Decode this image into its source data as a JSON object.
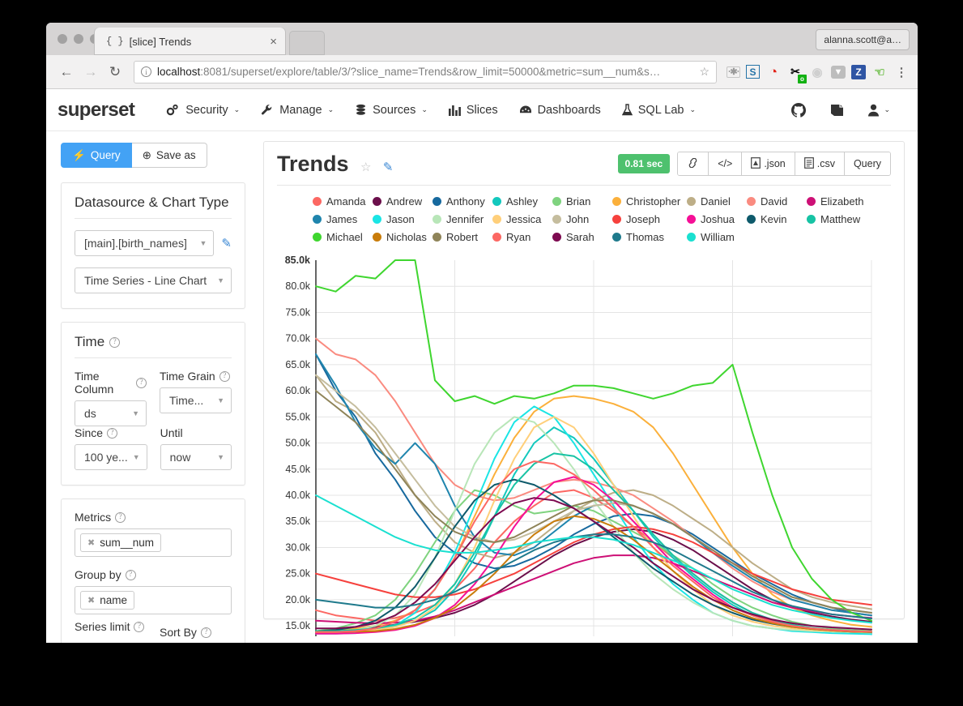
{
  "browser": {
    "tab": {
      "favicon": "{ }",
      "title": "[slice] Trends",
      "close": "×"
    },
    "nav": {
      "back": "←",
      "forward": "→",
      "reload": "↻"
    },
    "url": {
      "host": "localhost",
      "rest": ":8081/superset/explore/table/3/?slice_name=Trends&row_limit=50000&metric=sum__num&s…",
      "info_icon": "info-icon",
      "star_icon": "bookmark-star-icon"
    },
    "profile": "alanna.scott@a…",
    "extensions": [
      "puzzle-icon",
      "s-icon",
      "opera-icon",
      "screenshot-icon",
      "target-icon",
      "pocket-icon",
      "zotero-icon",
      "hangouts-icon",
      "chrome-menu-icon"
    ]
  },
  "navbar": {
    "brand": "superset",
    "items": [
      {
        "label": "Security",
        "icon": "gears-icon",
        "caret": "⌄"
      },
      {
        "label": "Manage",
        "icon": "wrench-icon",
        "caret": "⌄"
      },
      {
        "label": "Sources",
        "icon": "database-icon",
        "caret": "⌄"
      },
      {
        "label": "Slices",
        "icon": "bar-chart-icon",
        "caret": ""
      },
      {
        "label": "Dashboards",
        "icon": "dashboard-icon",
        "caret": ""
      },
      {
        "label": "SQL Lab",
        "icon": "flask-icon",
        "caret": "⌄"
      }
    ],
    "right_icons": [
      "github-icon",
      "book-icon",
      "user-icon"
    ],
    "user_caret": "⌄"
  },
  "sidebar": {
    "query_button": "Query",
    "query_icon": "⚡",
    "save_button": "Save as",
    "save_icon": "⊕",
    "datasource_panel": {
      "title": "Datasource & Chart Type",
      "datasource": "[main].[birth_names]",
      "edit_icon": "edit-datasource-icon",
      "viz_type": "Time Series - Line Chart"
    },
    "time_panel": {
      "title": "Time",
      "time_column_label": "Time Column",
      "time_column_value": "ds",
      "time_grain_label": "Time Grain",
      "time_grain_value": "Time...",
      "since_label": "Since",
      "since_value": "100 ye...",
      "until_label": "Until",
      "until_value": "now"
    },
    "query_panel": {
      "metrics_label": "Metrics",
      "metrics_token": "sum__num",
      "groupby_label": "Group by",
      "groupby_token": "name",
      "series_limit_label": "Series limit",
      "sort_by_label": "Sort By",
      "token_x": "✖"
    },
    "help_icon": "?"
  },
  "chart_panel": {
    "title": "Trends",
    "star_icon": "☆",
    "edit_icon": "✎",
    "duration_badge": "0.81 sec",
    "buttons": [
      {
        "label": "",
        "icon": "link-icon"
      },
      {
        "label": "",
        "icon": "code-icon"
      },
      {
        "label": ".json",
        "icon": "file-json-icon"
      },
      {
        "label": ".csv",
        "icon": "file-csv-icon"
      },
      {
        "label": "Query",
        "icon": ""
      }
    ]
  },
  "chart_data": {
    "type": "line",
    "title": "Trends",
    "xlabel": "",
    "ylabel": "",
    "ylim": [
      13000,
      85000
    ],
    "yticks": [
      "85.0k",
      "80.0k",
      "75.0k",
      "70.0k",
      "65.0k",
      "60.0k",
      "55.0k",
      "50.0k",
      "45.0k",
      "40.0k",
      "35.0k",
      "30.0k",
      "25.0k",
      "20.0k",
      "15.0k"
    ],
    "grid": true,
    "legend_position": "top",
    "legend_columns": 5,
    "x": [
      0,
      1,
      2,
      3,
      4,
      5,
      6,
      7,
      8,
      9,
      10,
      11,
      12,
      13,
      14,
      15,
      16,
      17,
      18,
      19,
      20,
      21,
      22,
      23,
      24,
      25,
      26,
      27,
      28
    ],
    "series": [
      {
        "name": "Amanda",
        "color": "#fc6863",
        "values": [
          18000,
          17000,
          16500,
          16000,
          16500,
          17500,
          19000,
          22000,
          26000,
          31000,
          35000,
          38000,
          40500,
          41000,
          39500,
          37000,
          34000,
          31000,
          28000,
          25000,
          22000,
          19500,
          17500,
          16000,
          15000,
          14500,
          14000,
          13800,
          13500
        ]
      },
      {
        "name": "Andrew",
        "color": "#6b0f4b",
        "values": [
          14000,
          14200,
          14500,
          14800,
          15200,
          15800,
          16500,
          17500,
          19000,
          21000,
          23500,
          26000,
          28500,
          30500,
          32000,
          33000,
          33500,
          33000,
          31500,
          29500,
          27000,
          24500,
          22000,
          20000,
          18500,
          17500,
          16800,
          16200,
          15800
        ]
      },
      {
        "name": "Anthony",
        "color": "#17699e",
        "values": [
          67000,
          60000,
          55000,
          48000,
          43000,
          37000,
          32000,
          29000,
          27000,
          26000,
          26500,
          28000,
          30000,
          32500,
          34500,
          36000,
          36500,
          36000,
          34500,
          32500,
          30000,
          27500,
          25000,
          23000,
          21000,
          19500,
          18500,
          17500,
          17000
        ]
      },
      {
        "name": "Ashley",
        "color": "#13c8bd",
        "values": [
          14000,
          14000,
          14200,
          14500,
          15000,
          16000,
          18000,
          22000,
          28000,
          36000,
          44000,
          50000,
          53000,
          51000,
          47000,
          42000,
          37000,
          32000,
          28000,
          24500,
          21500,
          19000,
          17000,
          15800,
          15000,
          14500,
          14200,
          14000,
          13800
        ]
      },
      {
        "name": "Brian",
        "color": "#7fd37f",
        "values": [
          14000,
          14500,
          15500,
          17000,
          20000,
          25000,
          31000,
          37000,
          41000,
          40000,
          38000,
          36500,
          37000,
          38000,
          37000,
          35000,
          33000,
          31000,
          28500,
          26000,
          23000,
          20500,
          18500,
          17000,
          15800,
          15000,
          14500,
          14200,
          14000
        ]
      },
      {
        "name": "Christopher",
        "color": "#fbb03b",
        "values": [
          14000,
          14200,
          14500,
          15000,
          16000,
          18000,
          22000,
          28000,
          36000,
          44000,
          51000,
          56000,
          58500,
          59000,
          58500,
          57500,
          56000,
          53000,
          48000,
          42000,
          36000,
          30000,
          25000,
          21000,
          18500,
          17000,
          16000,
          15200,
          14800
        ]
      },
      {
        "name": "Daniel",
        "color": "#bdae87",
        "values": [
          63000,
          58000,
          56000,
          52000,
          46000,
          40000,
          35000,
          31000,
          29000,
          28000,
          29000,
          31000,
          34000,
          37000,
          39000,
          40500,
          41000,
          40000,
          38000,
          35500,
          33000,
          30000,
          27000,
          24500,
          22000,
          20500,
          19500,
          18800,
          18200
        ]
      },
      {
        "name": "David",
        "color": "#fa8b80",
        "values": [
          70000,
          67000,
          66000,
          63000,
          58000,
          52000,
          46000,
          42000,
          40000,
          39000,
          39500,
          41000,
          42500,
          43000,
          42500,
          41500,
          40000,
          37500,
          35000,
          32000,
          29000,
          26000,
          23500,
          21500,
          20000,
          19000,
          18000,
          17500,
          17000
        ]
      },
      {
        "name": "Elizabeth",
        "color": "#cd1076",
        "values": [
          16000,
          15800,
          15600,
          15500,
          15600,
          16000,
          16800,
          18000,
          19500,
          21000,
          22500,
          24000,
          25500,
          27000,
          28000,
          28500,
          28500,
          28000,
          27000,
          25500,
          24000,
          22500,
          21000,
          19500,
          18500,
          17800,
          17200,
          16800,
          16500
        ]
      },
      {
        "name": "James",
        "color": "#1f85ad",
        "values": [
          67000,
          61000,
          54000,
          49000,
          46000,
          50000,
          46000,
          38000,
          32000,
          29000,
          28500,
          30000,
          33000,
          36000,
          38000,
          38500,
          38000,
          36500,
          34500,
          32000,
          29000,
          26500,
          24000,
          22000,
          20000,
          19000,
          18000,
          17500,
          17000
        ]
      },
      {
        "name": "Jason",
        "color": "#1ae5e5",
        "values": [
          13500,
          13500,
          13600,
          14000,
          15000,
          17500,
          22000,
          29000,
          38000,
          47000,
          54000,
          57000,
          55000,
          50000,
          44000,
          38000,
          32000,
          27000,
          23000,
          20000,
          17500,
          16000,
          15000,
          14500,
          14000,
          13800,
          13600,
          13500,
          13400
        ]
      },
      {
        "name": "Jennifer",
        "color": "#b8e6b8",
        "values": [
          14000,
          14000,
          14200,
          15000,
          17000,
          21000,
          28000,
          37000,
          46000,
          52000,
          55000,
          54000,
          50000,
          45000,
          39000,
          34000,
          29000,
          25000,
          22000,
          19500,
          17500,
          16000,
          15000,
          14500,
          14200,
          14000,
          13900,
          13800,
          13700
        ]
      },
      {
        "name": "Jessica",
        "color": "#ffcf7a",
        "values": [
          13800,
          13800,
          14000,
          14200,
          14800,
          16000,
          18500,
          23000,
          30000,
          39000,
          47000,
          53000,
          55000,
          53000,
          48000,
          42000,
          36000,
          30000,
          25500,
          22000,
          19000,
          17000,
          15800,
          15000,
          14500,
          14200,
          14000,
          13900,
          13800
        ]
      },
      {
        "name": "John",
        "color": "#c5bd9e",
        "values": [
          63000,
          60000,
          57000,
          53000,
          48000,
          43000,
          38000,
          34000,
          32000,
          31000,
          31500,
          33000,
          35000,
          37000,
          38000,
          38500,
          38000,
          36500,
          34500,
          32000,
          29500,
          27000,
          24500,
          22500,
          20500,
          19500,
          18500,
          18000,
          17500
        ]
      },
      {
        "name": "Joseph",
        "color": "#f6413d",
        "values": [
          25000,
          24000,
          23000,
          22000,
          21000,
          20500,
          20500,
          21000,
          22000,
          23500,
          25000,
          27000,
          29000,
          31000,
          32500,
          33500,
          34000,
          33500,
          32500,
          31000,
          29000,
          27000,
          25000,
          23500,
          22000,
          21000,
          20000,
          19500,
          19000
        ]
      },
      {
        "name": "Joshua",
        "color": "#f50f96",
        "values": [
          13500,
          13500,
          13600,
          13800,
          14200,
          15000,
          16500,
          19000,
          23000,
          28000,
          34000,
          39000,
          42500,
          43500,
          42000,
          39000,
          35000,
          31000,
          27000,
          24000,
          21000,
          18500,
          17000,
          15800,
          15000,
          14500,
          14200,
          14000,
          13800
        ]
      },
      {
        "name": "Kevin",
        "color": "#0e5a6b",
        "values": [
          14000,
          14200,
          14800,
          16000,
          18500,
          22500,
          28000,
          34000,
          39000,
          42000,
          43000,
          42000,
          40000,
          37500,
          35000,
          32000,
          29000,
          26000,
          23500,
          21000,
          19000,
          17500,
          16200,
          15400,
          14800,
          14400,
          14100,
          13900,
          13800
        ]
      },
      {
        "name": "Matthew",
        "color": "#17c3a4",
        "values": [
          14000,
          14000,
          14200,
          14500,
          15200,
          16500,
          19000,
          23000,
          29000,
          36000,
          42000,
          46000,
          48000,
          47500,
          45000,
          41000,
          37000,
          32500,
          28500,
          25000,
          22000,
          19500,
          17500,
          16200,
          15200,
          14600,
          14200,
          14000,
          13800
        ]
      },
      {
        "name": "Michael",
        "color": "#3fd62f",
        "values": [
          80000,
          79000,
          82000,
          81500,
          85000,
          85000,
          62000,
          58000,
          59000,
          57500,
          59000,
          58500,
          59500,
          61000,
          61000,
          60500,
          59500,
          58500,
          59500,
          61000,
          61500,
          65000,
          52000,
          40000,
          30000,
          24000,
          20000,
          17500,
          16000
        ]
      },
      {
        "name": "Nicholas",
        "color": "#c97c0a",
        "values": [
          13800,
          13800,
          13900,
          14000,
          14400,
          15200,
          16500,
          18500,
          21500,
          25000,
          29000,
          32500,
          35000,
          36000,
          35500,
          34000,
          31500,
          28500,
          25500,
          22500,
          20000,
          18000,
          16500,
          15500,
          14800,
          14400,
          14100,
          13900,
          13800
        ]
      },
      {
        "name": "Robert",
        "color": "#8f8459",
        "values": [
          60000,
          57000,
          54000,
          50000,
          45000,
          40000,
          36000,
          33000,
          31500,
          31000,
          32000,
          34000,
          36000,
          38000,
          39000,
          39000,
          38000,
          36500,
          34500,
          32000,
          29500,
          27000,
          24500,
          22500,
          20500,
          19500,
          18500,
          18000,
          17500
        ]
      },
      {
        "name": "Ryan",
        "color": "#fc6863",
        "values": [
          13800,
          13800,
          14000,
          14500,
          15800,
          18000,
          22000,
          28000,
          35000,
          41000,
          45000,
          46500,
          46000,
          44000,
          41000,
          37500,
          34000,
          30000,
          26500,
          23500,
          20500,
          18500,
          17000,
          15800,
          15000,
          14500,
          14200,
          14000,
          13900
        ]
      },
      {
        "name": "Sarah",
        "color": "#7d0a50",
        "values": [
          14500,
          14500,
          14800,
          15500,
          17000,
          19500,
          23000,
          27500,
          32000,
          36000,
          38500,
          39500,
          39000,
          37500,
          35000,
          32500,
          30000,
          27000,
          24500,
          22000,
          20000,
          18500,
          17200,
          16200,
          15500,
          15000,
          14700,
          14500,
          14300
        ]
      },
      {
        "name": "Thomas",
        "color": "#1f7a8c",
        "values": [
          20000,
          19500,
          19000,
          18500,
          18500,
          19000,
          20000,
          21500,
          23500,
          25500,
          27500,
          29500,
          31000,
          32000,
          32500,
          32500,
          32000,
          31000,
          29500,
          27500,
          25500,
          23500,
          21500,
          20000,
          18800,
          18000,
          17200,
          16800,
          16400
        ]
      },
      {
        "name": "William",
        "color": "#1ae0d0",
        "values": [
          40000,
          38000,
          36000,
          34000,
          32000,
          30500,
          29500,
          29000,
          29000,
          29500,
          30000,
          31000,
          31500,
          32000,
          32000,
          31500,
          30500,
          29000,
          27500,
          26000,
          24000,
          22000,
          20500,
          19000,
          18000,
          17200,
          16500,
          16000,
          15600
        ]
      }
    ],
    "legend": [
      [
        "Amanda",
        "Andrew",
        "Anthony",
        "Ashley",
        "Brian",
        "Christopher",
        "Daniel",
        "David",
        "Elizabeth"
      ],
      [
        "James",
        "Jason",
        "Jennifer",
        "Jessica",
        "John",
        "Joseph",
        "Joshua",
        "Kevin",
        "Matthew"
      ],
      [
        "Michael",
        "Nicholas",
        "Robert",
        "Ryan",
        "Sarah",
        "Thomas",
        "William"
      ]
    ]
  }
}
